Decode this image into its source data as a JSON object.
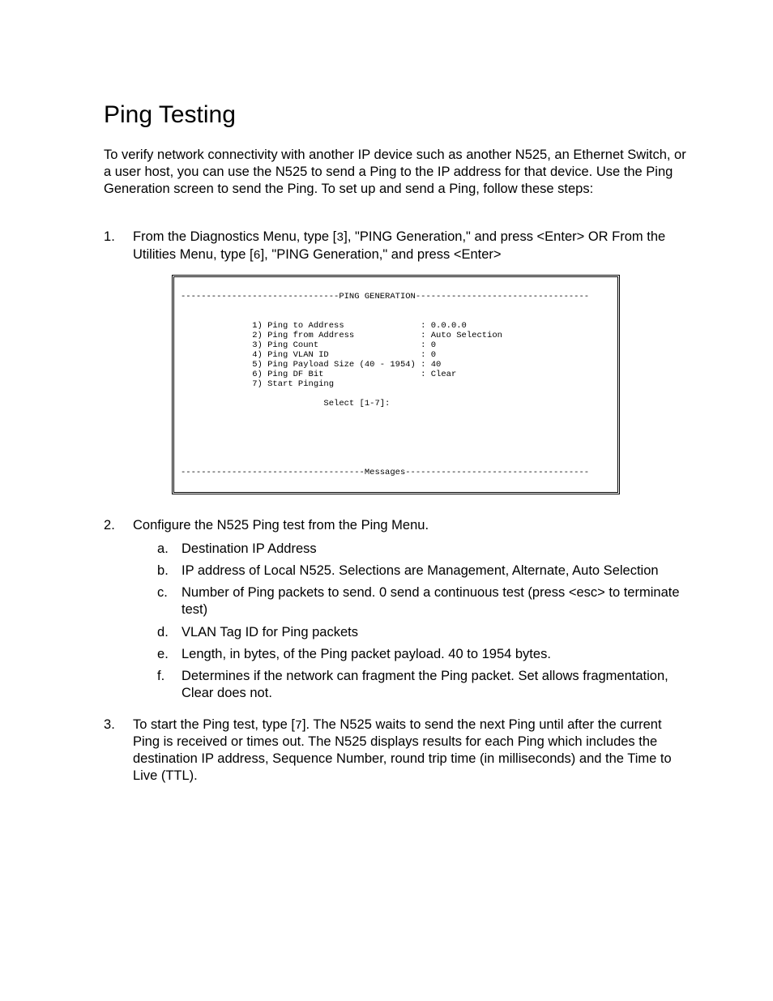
{
  "title": "Ping Testing",
  "intro": "To verify network connectivity with another IP device such as another N525, an Ethernet Switch, or a user host, you can use the N525 to send a Ping to the IP address for that device. Use the Ping Generation screen to send the Ping. To set up and send a Ping, follow these steps:",
  "step1": {
    "pre1": "From the Diagnostics Menu, type [",
    "code1": "3",
    "post1": "], \"PING Generation,\" and press <Enter> OR From the Utilities Menu, type [",
    "code2": "6",
    "post2": "], \"PING Generation,\" and press <Enter>"
  },
  "terminal": "\n-------------------------------PING GENERATION----------------------------------\n\n\n              1) Ping to Address               : 0.0.0.0\n              2) Ping from Address             : Auto Selection\n              3) Ping Count                    : 0\n              4) Ping VLAN ID                  : 0\n              5) Ping Payload Size (40 - 1954) : 40\n              6) Ping DF Bit                   : Clear\n              7) Start Pinging\n\n                            Select [1-7]:\n\n\n\n\n\n\n------------------------------------Messages------------------------------------\n\n",
  "step2": {
    "text": "Configure the N525 Ping test from the Ping Menu.",
    "items": [
      "Destination IP Address",
      "IP address of Local N525. Selections are Management, Alternate, Auto Selection",
      "Number of Ping packets to send. 0 send a continuous test (press <esc> to terminate test)",
      "VLAN Tag ID for Ping packets",
      "Length, in bytes, of the Ping packet payload. 40 to 1954 bytes.",
      "Determines if the network can fragment the Ping packet. Set allows fragmentation, Clear does not."
    ]
  },
  "step3": {
    "pre": "To start the Ping test, type [",
    "code": "7",
    "post": "]. The N525 waits to send the next Ping until after the current Ping is received or times out. The N525 displays results for each Ping which includes the destination IP address, Sequence Number, round trip time (in milliseconds) and the Time to Live (TTL)."
  }
}
